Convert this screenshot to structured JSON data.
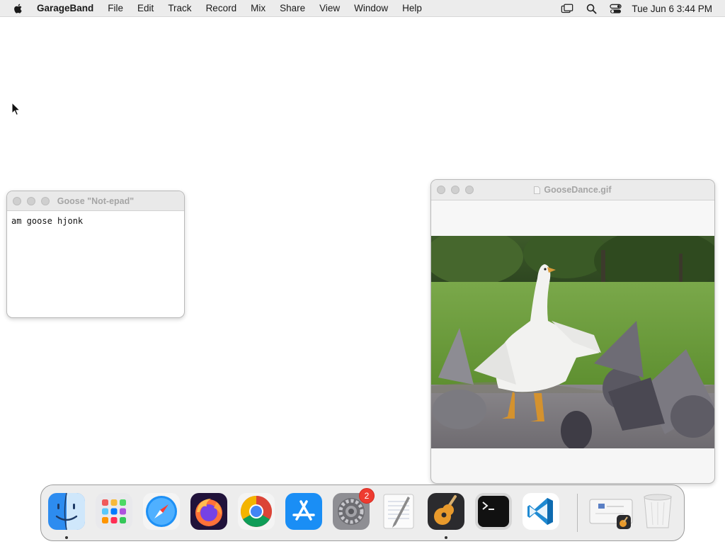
{
  "menubar": {
    "apple_icon": "apple-logo-icon",
    "app_name": "GarageBand",
    "menus": [
      "File",
      "Edit",
      "Track",
      "Record",
      "Mix",
      "Share",
      "View",
      "Window",
      "Help"
    ],
    "status_icons": [
      "screen-mirroring-icon",
      "spotlight-search-icon",
      "control-center-icon"
    ],
    "clock": "Tue Jun 6  3:44 PM"
  },
  "notepad_window": {
    "title": "Goose \"Not-epad\"",
    "content": "am goose hjonk"
  },
  "gif_window": {
    "title": "GooseDance.gif",
    "image_icon": "goose-dancing-with-pigeons-image"
  },
  "dock": {
    "apps": [
      {
        "name": "Finder",
        "icon": "finder-icon",
        "running": true
      },
      {
        "name": "Launchpad",
        "icon": "launchpad-icon",
        "running": false
      },
      {
        "name": "Safari",
        "icon": "safari-icon",
        "running": false
      },
      {
        "name": "Firefox",
        "icon": "firefox-icon",
        "running": false
      },
      {
        "name": "Chrome",
        "icon": "chrome-icon",
        "running": false
      },
      {
        "name": "App Store",
        "icon": "app-store-icon",
        "running": false
      },
      {
        "name": "System Settings",
        "icon": "system-settings-icon",
        "running": false,
        "badge": "2"
      },
      {
        "name": "TextEdit",
        "icon": "textedit-icon",
        "running": false
      },
      {
        "name": "GarageBand",
        "icon": "garageband-icon",
        "running": true
      },
      {
        "name": "Terminal",
        "icon": "terminal-icon",
        "running": false
      },
      {
        "name": "Visual Studio Code",
        "icon": "vscode-icon",
        "running": false
      },
      {
        "name": "Recent document",
        "icon": "recent-document-icon",
        "running": false
      },
      {
        "name": "Trash",
        "icon": "trash-icon",
        "running": false
      }
    ]
  },
  "colors": {
    "menubar_bg": "#ececec",
    "badge_red": "#ee3b30",
    "grass_green": "#6ea03b"
  }
}
